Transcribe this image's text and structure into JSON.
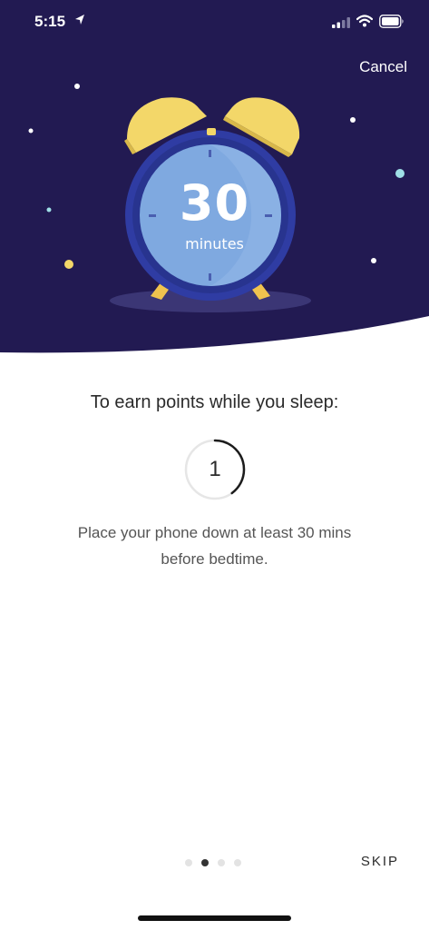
{
  "status_bar": {
    "time": "5:15",
    "icons": [
      "location-arrow-icon",
      "signal-icon",
      "wifi-icon",
      "battery-icon"
    ]
  },
  "header": {
    "cancel_label": "Cancel"
  },
  "clock": {
    "value": "30",
    "unit": "minutes"
  },
  "content": {
    "heading": "To earn points while you sleep:",
    "step_number": "1",
    "step_progress": 0.4,
    "description_line1": "Place your phone down at least 30 mins",
    "description_line2": "before bedtime."
  },
  "pagination": {
    "total": 4,
    "active_index": 1
  },
  "footer": {
    "skip_label": "SKIP"
  },
  "colors": {
    "night_sky": "#221a52",
    "clock_blue": "#2f3ca3",
    "clock_face": "#7fa9e0",
    "bell_yellow": "#f3d769",
    "star_teal": "#9fdfe6"
  }
}
